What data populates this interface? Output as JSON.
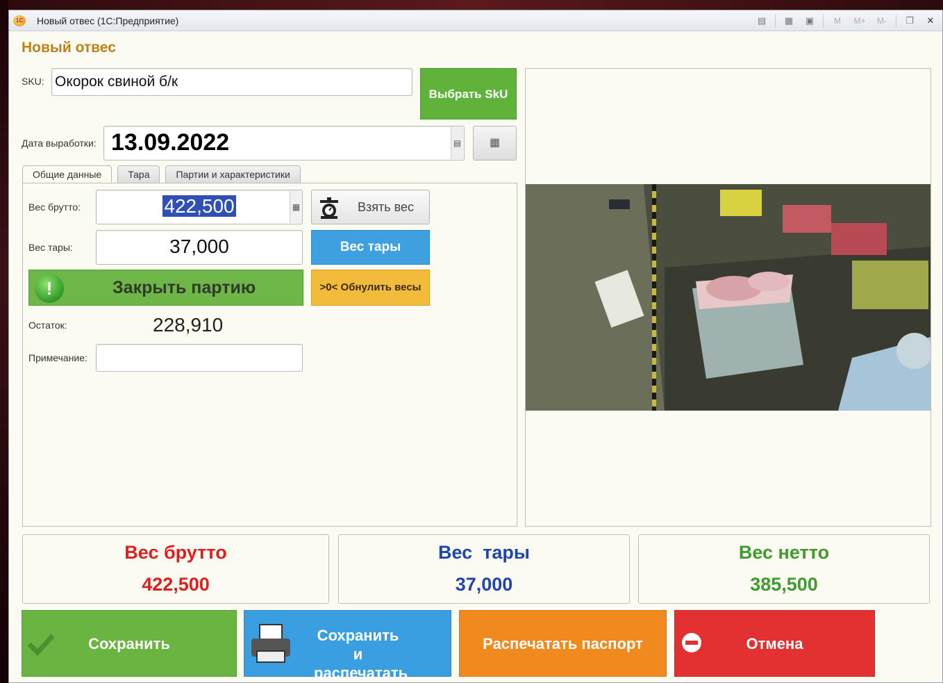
{
  "window": {
    "title": "Новый отвес  (1С:Предприятие)",
    "logo_text": "1C",
    "toolbar_icons": [
      "document-icon",
      "calculator-icon",
      "calendar-icon"
    ],
    "memory_buttons": [
      "M",
      "M+",
      "M-"
    ]
  },
  "form": {
    "title": "Новый отвес",
    "sku_label": "SKU:",
    "sku_value": "Окорок свиной б/к",
    "choose_sku_button": "Выбрать SkU",
    "date_label": "Дата выработки:",
    "date_value": "13.09.2022"
  },
  "tabs": [
    {
      "label": "Общие данные",
      "active": true
    },
    {
      "label": "Тара",
      "active": false
    },
    {
      "label": "Партии и характеристики",
      "active": false
    }
  ],
  "general": {
    "gross_label": "Вес брутто:",
    "gross_value": "422,500",
    "take_weight_button": "Взять вес",
    "tare_label": "Вес тары:",
    "tare_value": "37,000",
    "tare_button": "Вес тары",
    "close_batch_button": "Закрыть партию",
    "reset_scale_button": ">0< Обнулить весы",
    "remainder_label": "Остаток:",
    "remainder_value": "228,910",
    "note_label": "Примечание:",
    "note_value": ""
  },
  "summary": {
    "gross": {
      "title": "Вес брутто",
      "value": "422,500",
      "color": "#de1f1f"
    },
    "tare": {
      "title": "Вес  тары",
      "value": "37,000",
      "color": "#1f46a8"
    },
    "net": {
      "title": "Вес нетто",
      "value": "385,500",
      "color": "#3f9a2f"
    }
  },
  "actions": {
    "save": "Сохранить",
    "save_print": "Сохранить и распечатать",
    "print_passport": "Распечатать паспорт",
    "cancel": "Отмена"
  },
  "colors": {
    "accent_green": "#6ab441",
    "accent_blue": "#3a9fe0",
    "accent_orange": "#f08a1e",
    "accent_red": "#e33030",
    "accent_yellow": "#f2bb3c",
    "title_color": "#c07f1c"
  }
}
